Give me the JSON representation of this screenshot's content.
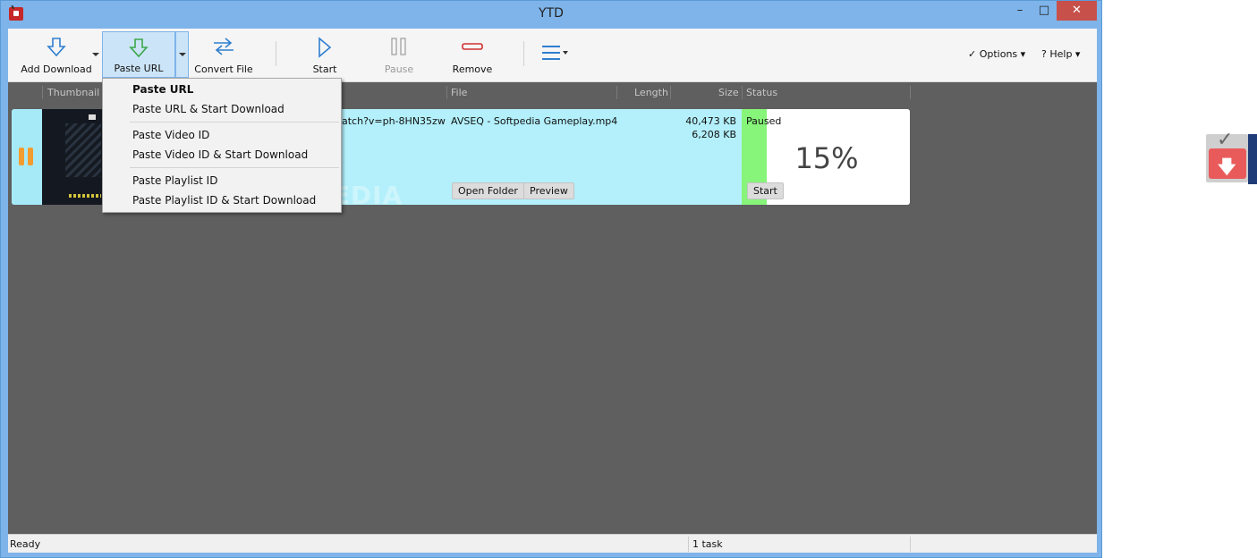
{
  "window": {
    "title": "YTD"
  },
  "toolbar": {
    "add_download": "Add Download",
    "paste_url": "Paste URL",
    "convert_file": "Convert File",
    "start": "Start",
    "pause": "Pause",
    "remove": "Remove",
    "options": "Options",
    "help": "Help"
  },
  "columns": {
    "thumbnail": "Thumbnail",
    "file": "File",
    "length": "Length",
    "size": "Size",
    "status": "Status"
  },
  "download": {
    "url_fragment": "atch?v=ph-8HN35zw",
    "file_name": "AVSEQ - Softpedia Gameplay.mp4",
    "size_total": "40,473 KB",
    "size_done": "6,208 KB",
    "status": "Paused",
    "percent": "15%",
    "progress": 0.15,
    "open_folder": "Open Folder",
    "preview": "Preview",
    "start": "Start"
  },
  "watermark": "SOFTPEDIA",
  "paste_menu": {
    "items": [
      "Paste URL",
      "Paste URL & Start Download",
      "Paste Video ID",
      "Paste Video ID & Start Download",
      "Paste Playlist ID",
      "Paste Playlist ID & Start Download"
    ]
  },
  "statusbar": {
    "state": "Ready",
    "tasks": "1 task"
  },
  "colors": {
    "accent": "#7eb4ea",
    "row_bg": "#b3f0fb",
    "status_green": "#86f57a",
    "pause_orange": "#f39c2f",
    "list_bg": "#5f5f5f"
  }
}
